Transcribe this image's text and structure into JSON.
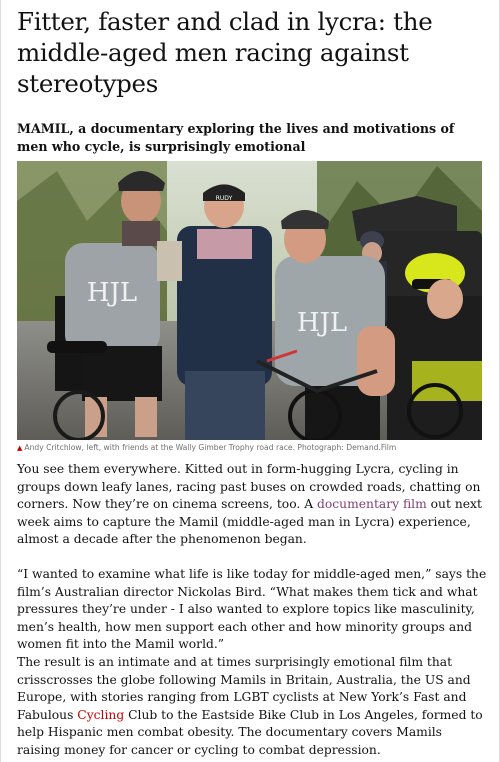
{
  "article": {
    "headline": "Fitter, faster and clad in lycra: the middle-aged men racing against stereotypes",
    "standfirst": "MAMIL, a documentary exploring the lives and motivations of men who cycle, is surprisingly emotional",
    "image": {
      "caption": "Andy Critchlow, left, with friends at the Wally Gimber Trophy road race. Photograph: Demand.Film",
      "jersey_text": "HJL",
      "cap_text": "RUDY"
    },
    "paragraphs": {
      "p1_before": "You see them everywhere. Kitted out in form-hugging Lycra, cycling in groups down leafy lanes, racing past buses on crowded roads, chatting on corners. Now they’re on cinema screens, too. A ",
      "p1_link": "documentary film",
      "p1_after": " out next week aims to capture the Mamil (middle-aged man in Lycra) experience, almost a decade after the phenomenon began.",
      "p2": "“I wanted to examine what life is like today for middle-aged men,” says the film’s Australian director Nickolas Bird. “What makes them tick and what pressures they’re under - I also wanted to explore topics like masculinity, men’s health, how men support each other and how minority groups and women fit into the Mamil world.”",
      "p3_before": "The result is an intimate and at times surprisingly emotional film that crisscrosses the globe following Mamils in Britain, Australia, the US and Europe, with stories ranging from LGBT cyclists at New York’s Fast and Fabulous ",
      "p3_link": "Cycling",
      "p3_after": " Club to the Eastside Bike Club in Los Angeles, formed to help Hispanic men combat obesity. The documentary covers Mamils raising money for cancer or cycling to combat depression."
    }
  },
  "colors": {
    "text": "#121212",
    "caption": "#707070",
    "caption_marker": "#c70000",
    "link": "#c70000",
    "link_visited": "#7d3f74"
  }
}
